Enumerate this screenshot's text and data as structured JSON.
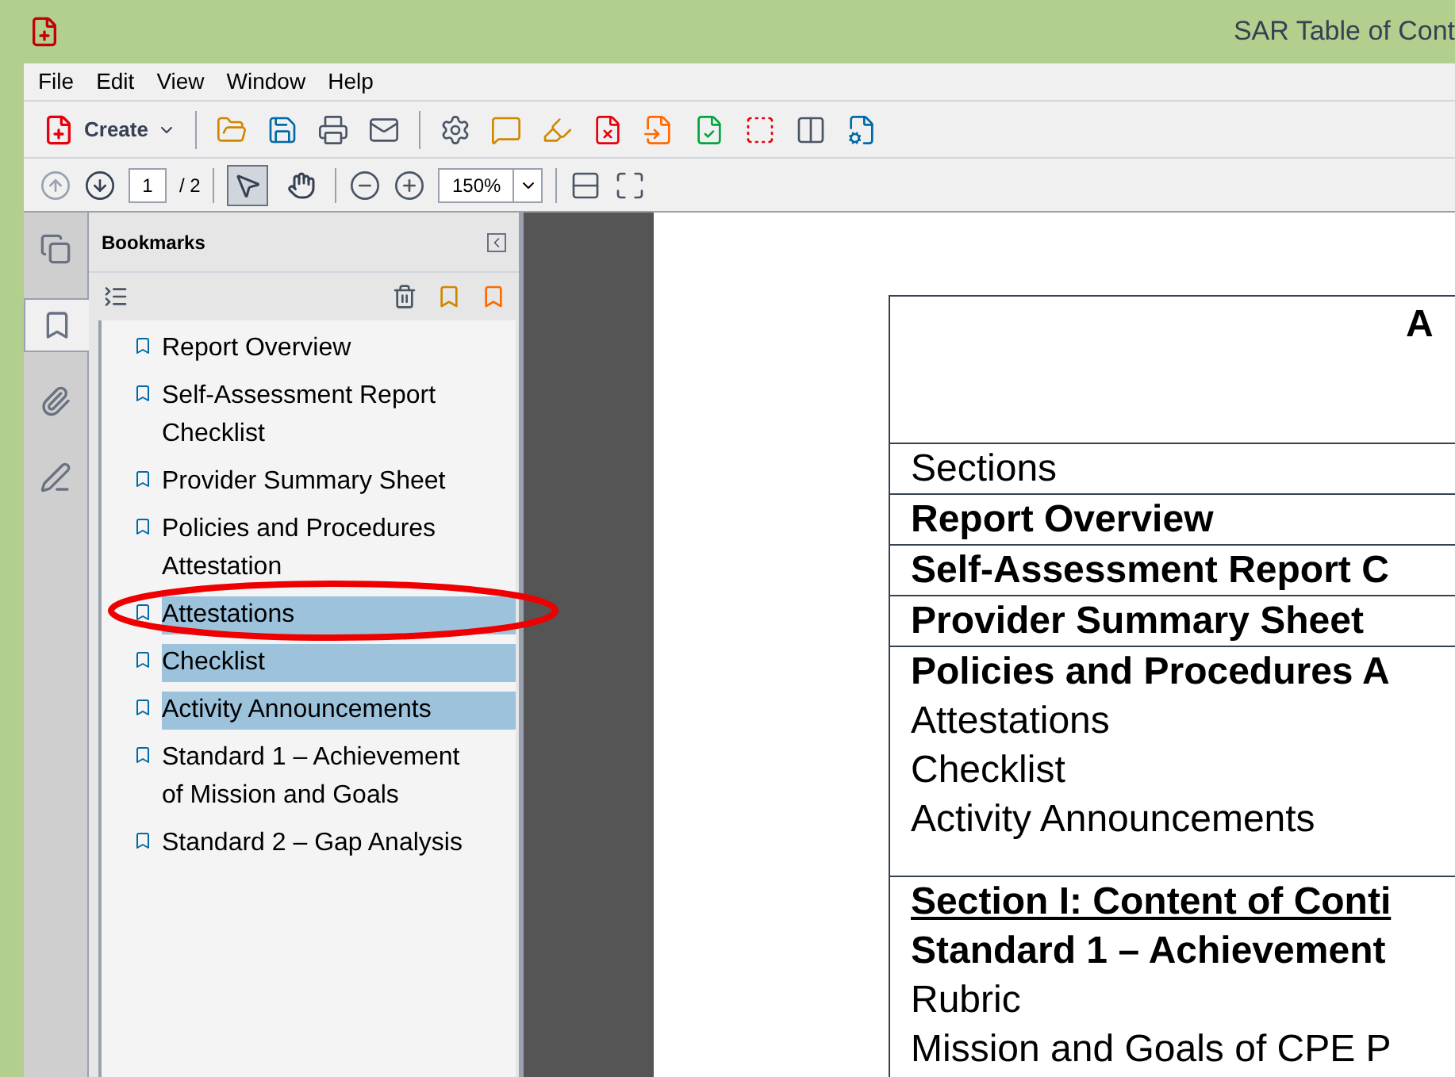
{
  "window": {
    "title": "SAR Table of Cont"
  },
  "menu": [
    "File",
    "Edit",
    "View",
    "Window",
    "Help"
  ],
  "toolbar": {
    "create_label": "Create"
  },
  "nav_toolbar": {
    "page": "1",
    "page_total": "/ 2",
    "zoom": "150%",
    "tools": [
      {
        "kind": "select",
        "selected": true
      },
      {
        "kind": "hand",
        "selected": false
      }
    ]
  },
  "side_tabs": [
    {
      "kind": "pages",
      "selected": false
    },
    {
      "kind": "bookmarks",
      "selected": true
    },
    {
      "kind": "attachments",
      "selected": false
    },
    {
      "kind": "signatures",
      "selected": false
    }
  ],
  "bookmarks": {
    "title": "Bookmarks",
    "items": [
      {
        "label": "Report Overview",
        "selected": false
      },
      {
        "label": "Self-Assessment Report Checklist",
        "selected": false
      },
      {
        "label": "Provider Summary Sheet",
        "selected": false
      },
      {
        "label": "Policies and Procedures Attestation",
        "selected": false
      },
      {
        "label": "Attestations",
        "selected": true
      },
      {
        "label": "Checklist",
        "selected": true
      },
      {
        "label": "Activity Announcements",
        "selected": true
      },
      {
        "label": "Standard 1 – Achievement of Mission and Goals",
        "selected": false
      },
      {
        "label": "Standard 2 – Gap Analysis",
        "selected": false
      }
    ]
  },
  "document": {
    "heading": "A",
    "rows": [
      {
        "lines": [
          {
            "text": "Sections",
            "kind": "plain"
          }
        ]
      },
      {
        "lines": [
          {
            "text": "Report Overview",
            "kind": "bold"
          }
        ]
      },
      {
        "lines": [
          {
            "text": "Self-Assessment Report C",
            "kind": "bold"
          }
        ]
      },
      {
        "lines": [
          {
            "text": "Provider Summary Sheet",
            "kind": "bold"
          }
        ]
      },
      {
        "lines": [
          {
            "text": "Policies and Procedures A",
            "kind": "bold"
          },
          {
            "text": "Attestations",
            "kind": "plain"
          },
          {
            "text": "Checklist",
            "kind": "plain"
          },
          {
            "text": "Activity Announcements",
            "kind": "plain"
          }
        ]
      },
      {
        "lines": [
          {
            "text": "Section I: Content of Conti",
            "kind": "underline"
          },
          {
            "text": "Standard 1 – Achievement",
            "kind": "bold"
          },
          {
            "text": "Rubric",
            "kind": "plain"
          },
          {
            "text": "Mission and Goals of CPE P",
            "kind": "plain"
          }
        ]
      }
    ]
  }
}
